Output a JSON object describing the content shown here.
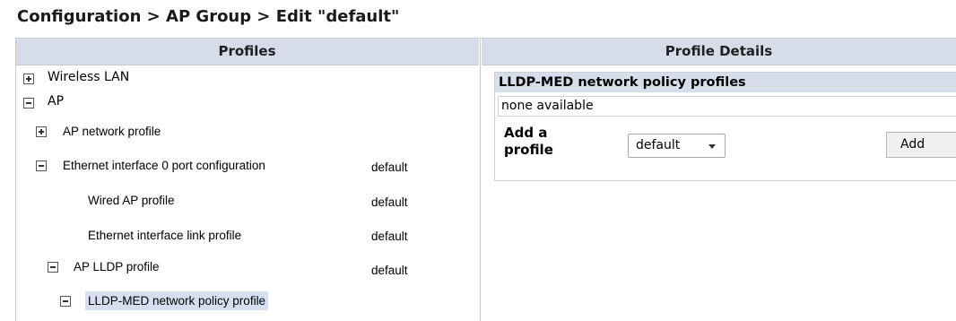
{
  "page": {
    "title": "Configuration > AP Group > Edit \"default\""
  },
  "columns": {
    "profiles": "Profiles",
    "details": "Profile Details"
  },
  "tree": {
    "wireless_lan": "Wireless LAN",
    "ap": "AP",
    "ap_network_profile": "AP network profile",
    "eth0_port_config": {
      "label": "Ethernet interface 0 port configuration",
      "value": "default"
    },
    "wired_ap_profile": {
      "label": "Wired AP profile",
      "value": "default"
    },
    "eth_link_profile": {
      "label": "Ethernet interface link profile",
      "value": "default"
    },
    "ap_lldp_profile": {
      "label": "AP LLDP profile",
      "value": "default"
    },
    "lldp_med_profile": "LLDP-MED network policy profile"
  },
  "details": {
    "header": "LLDP-MED network policy profiles",
    "empty_text": "none available",
    "add_label_line1": "Add a",
    "add_label_line2": "profile",
    "select_value": "default",
    "add_button": "Add"
  }
}
